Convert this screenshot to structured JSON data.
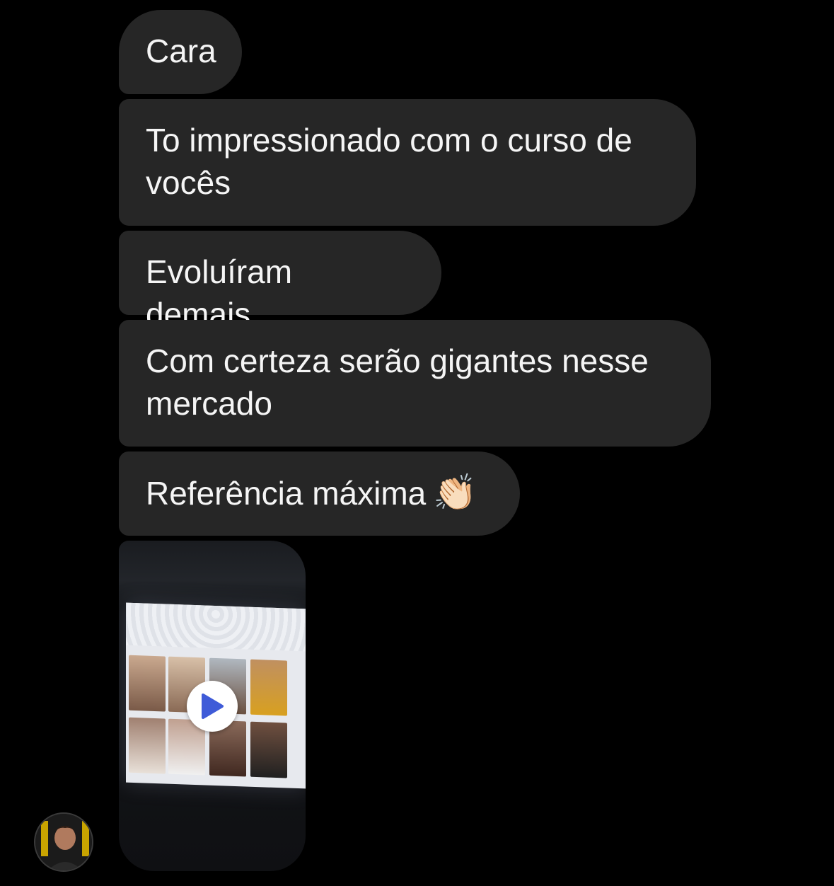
{
  "messages": [
    {
      "text": "Cara"
    },
    {
      "text": "To impressionado com o curso de vocês"
    },
    {
      "text": "Evoluíram demais"
    },
    {
      "text": "Com certeza serão gigantes nesse mercado"
    },
    {
      "text": "Referência máxima",
      "emoji": "👏🏻"
    }
  ],
  "video_message": {
    "icon": "play-icon"
  },
  "sender": {
    "avatar_icon": "avatar"
  },
  "colors": {
    "background": "#000000",
    "bubble": "#262626",
    "text": "#f5f5f5",
    "play": "#3f5bd8"
  }
}
